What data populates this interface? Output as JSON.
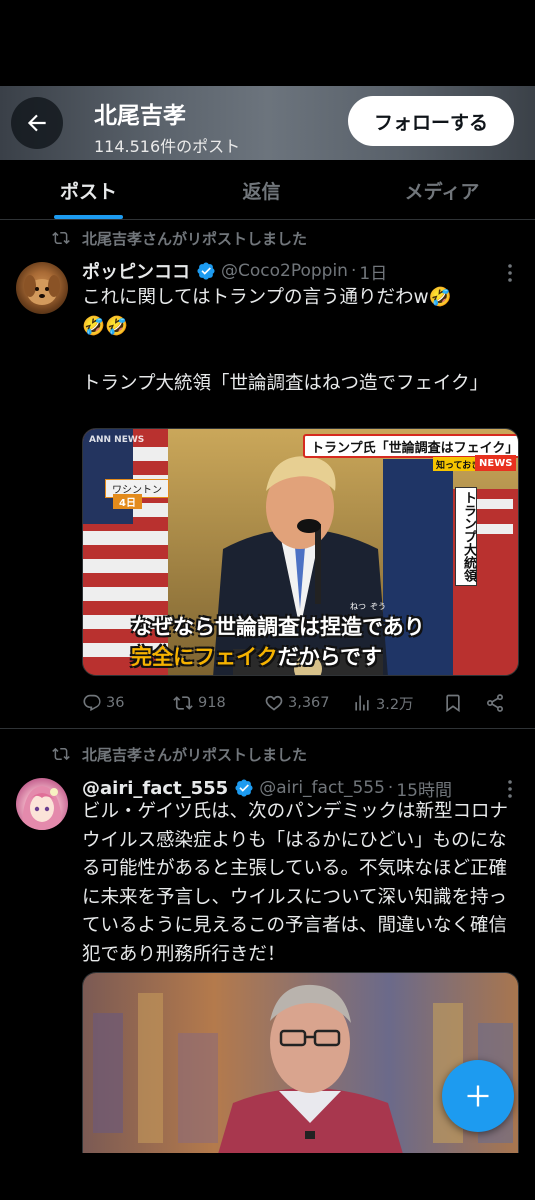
{
  "header": {
    "title": "北尾吉孝",
    "subtitle": "114.516件のポスト",
    "follow_label": "フォローする"
  },
  "tabs": [
    {
      "label": "ポスト",
      "active": true
    },
    {
      "label": "返信",
      "active": false
    },
    {
      "label": "メディア",
      "active": false
    }
  ],
  "posts": [
    {
      "repost_label": "北尾吉孝さんがリポストしました",
      "display_name": "ポッピンココ",
      "handle": "@Coco2Poppin",
      "time": "1日",
      "text": "これに関してはトランプの言う通りだわw🤣\n🤣🤣\n\nトランプ大統領「世論調査はねつ造でフェイク」",
      "media": {
        "banner_text": "トランプ氏「世論調査はフェイク」",
        "banner_sub": "知っておきたい",
        "news_label": "NEWS",
        "channel_label": "ANN NEWS",
        "location_label": "ワシントン",
        "date_label": "4日",
        "vertical_label": "トランプ大統領",
        "caption_line1": "なぜなら世論調査は捏造であり",
        "caption_highlight": "完全にフェイク",
        "caption_rest": "だからです",
        "ruby_1": "ねつ",
        "ruby_2": "ぞう"
      },
      "stats": {
        "replies": "36",
        "reposts": "918",
        "likes": "3,367",
        "views": "3.2万"
      }
    },
    {
      "repost_label": "北尾吉孝さんがリポストしました",
      "display_name": "@airi_fact_555",
      "handle": "@airi_fact_555",
      "time": "15時間",
      "text": "ビル・ゲイツ氏は、次のパンデミックは新型コロナウイルス感染症よりも「はるかにひどい」ものになる可能性があると主張している。不気味なほど正確に未来を予言し、ウイルスについて深い知識を持っているように見えるこの予言者は、間違いなく確信犯であり刑務所行きだ！"
    }
  ],
  "colors": {
    "accent": "#1d9bf0",
    "background": "#000000",
    "text_primary": "#e7e9ea",
    "text_secondary": "#71767b",
    "border": "#2f3336"
  },
  "icons": [
    "back-arrow-icon",
    "repost-icon",
    "verified-badge-icon",
    "more-icon",
    "reply-icon",
    "like-icon",
    "views-icon",
    "bookmark-icon",
    "share-icon",
    "plus-icon"
  ]
}
